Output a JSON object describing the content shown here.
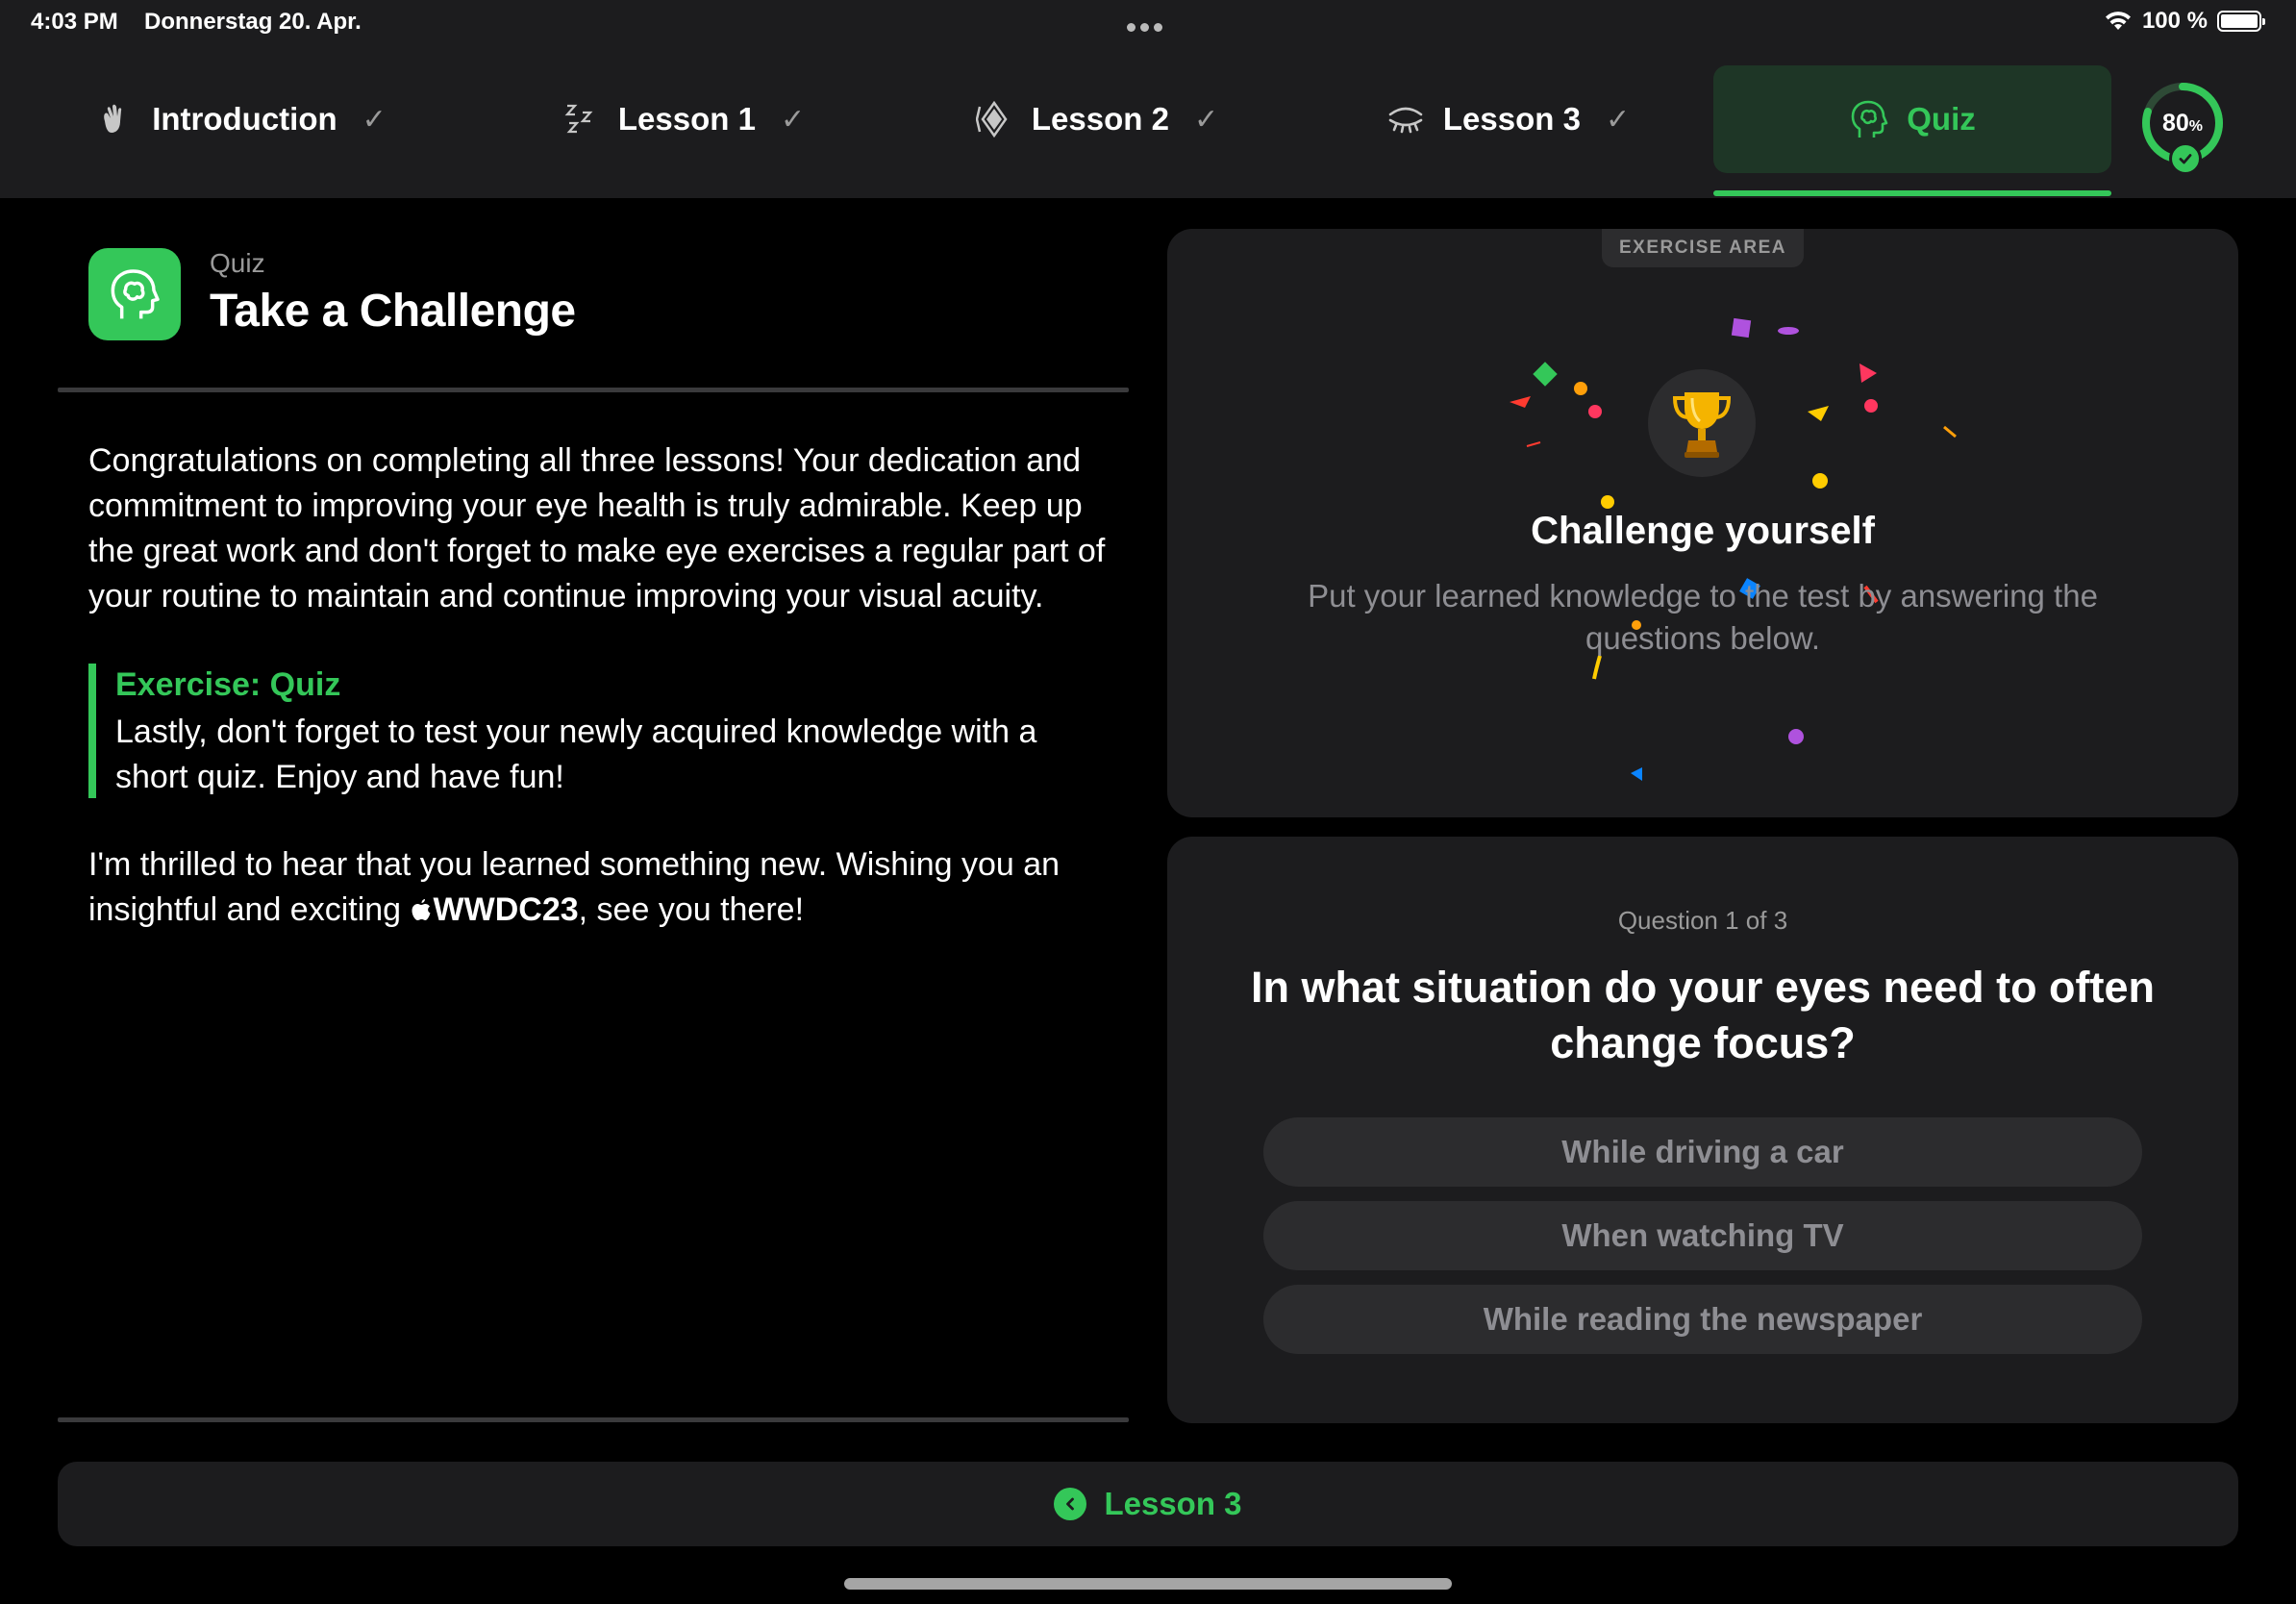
{
  "status_bar": {
    "time": "4:03 PM",
    "date": "Donnerstag 20. Apr.",
    "battery": "100 %"
  },
  "tabs": [
    {
      "label": "Introduction",
      "icon": "hand-wave-icon",
      "completed": true,
      "active": false
    },
    {
      "label": "Lesson 1",
      "icon": "zzz-sleep-icon",
      "completed": true,
      "active": false
    },
    {
      "label": "Lesson 2",
      "icon": "diamond-focus-icon",
      "completed": true,
      "active": false
    },
    {
      "label": "Lesson 3",
      "icon": "eye-closed-icon",
      "completed": true,
      "active": false
    },
    {
      "label": "Quiz",
      "icon": "brain-head-icon",
      "completed": false,
      "active": true
    }
  ],
  "progress": {
    "value": "80",
    "unit": "%",
    "fraction": 0.8,
    "color": "#34c759"
  },
  "header": {
    "eyebrow": "Quiz",
    "title": "Take a Challenge"
  },
  "content": {
    "paragraph1": "Congratulations on completing all three lessons! Your dedication and commitment to improving your eye health is truly admirable. Keep up the great work and don't forget to make eye exercises a regular part of your routine to maintain and continue improving your visual acuity.",
    "exercise_title": "Exercise: Quiz",
    "exercise_body": "Lastly, don't forget to test your newly acquired knowledge with a short quiz. Enjoy and have fun!",
    "paragraph2_before": "I'm thrilled to hear that you learned something new. Wishing you an insightful and exciting ",
    "paragraph2_highlight": "WWDC23",
    "paragraph2_after": ", see you there!"
  },
  "exercise_area": {
    "tag": "EXERCISE AREA",
    "title": "Challenge yourself",
    "subtitle": "Put your learned knowledge to the test by answering the questions below.",
    "trophy_icon": "trophy-icon"
  },
  "quiz": {
    "counter": "Question 1 of 3",
    "question": "In what situation do your eyes need to often change focus?",
    "answers": [
      "While driving a car",
      "When watching TV",
      "While reading the newspaper"
    ]
  },
  "footer": {
    "back_label": "Lesson 3"
  },
  "colors": {
    "accent": "#34c759",
    "panel": "#1c1c1e",
    "button": "#2c2c2e",
    "background": "#000000"
  }
}
